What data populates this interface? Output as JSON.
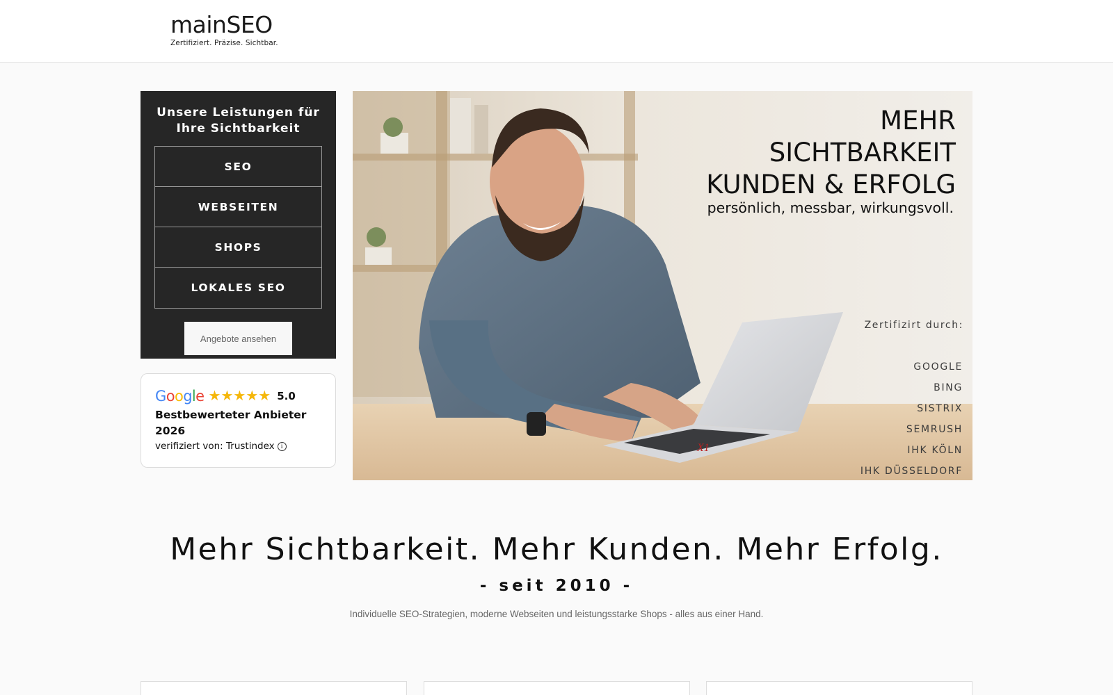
{
  "header": {
    "logo_name": "mainSEO",
    "logo_tagline": "Zertifiziert. Präzise. Sichtbar."
  },
  "services": {
    "title": "Unsere Leistungen für Ihre Sichtbarkeit",
    "items": [
      {
        "label": "SEO"
      },
      {
        "label": "WEBSEITEN"
      },
      {
        "label": "SHOPS"
      },
      {
        "label": "LOKALES SEO"
      }
    ],
    "button_label": "Angebote ansehen"
  },
  "review": {
    "brand": "Google",
    "stars": 5,
    "score": "5.0",
    "title": "Bestbewerteter Anbieter 2026",
    "verified": "verifiziert von: Trustindex",
    "info_icon": "info-icon",
    "star_color": "#f5b70a"
  },
  "hero": {
    "lines": [
      "MEHR",
      "SICHTBARKEIT",
      "KUNDEN & ERFOLG"
    ],
    "subline": "persönlich, messbar, wirkungsvoll.",
    "cert_label": "Zertifizirt durch:",
    "cert_items": [
      "GOOGLE",
      "BING",
      "SISTRIX",
      "SEMRUSH",
      "IHK KÖLN",
      "IHK DÜSSELDORF"
    ]
  },
  "main": {
    "tagline": "Mehr Sichtbarkeit. Mehr Kunden. Mehr Erfolg.",
    "since": "- seit 2010 -",
    "description": "Individuelle SEO-Strategien, moderne Webseiten und leistungsstarke Shops - alles aus einer Hand."
  },
  "colors": {
    "dark_panel": "#262626",
    "page_bg": "#fafafa"
  }
}
